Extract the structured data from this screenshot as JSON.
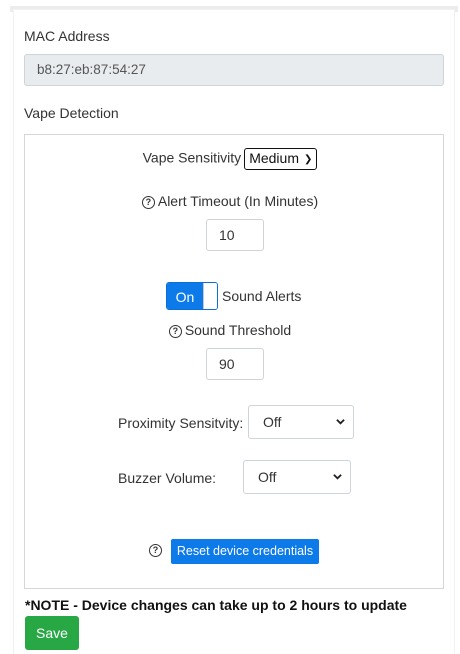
{
  "mac": {
    "label": "MAC Address",
    "value": "b8:27:eb:87:54:27"
  },
  "vape": {
    "section_label": "Vape Detection",
    "sensitivity_label": "Vape Sensitivity",
    "sensitivity_value": "Medium",
    "alert_timeout_label": "Alert Timeout (In Minutes)",
    "alert_timeout_value": "10",
    "sound_toggle_state": "On",
    "sound_alerts_label": "Sound Alerts",
    "sound_threshold_label": "Sound Threshold",
    "sound_threshold_value": "90",
    "proximity_label": "Proximity Sensitvity:",
    "proximity_value": "Off",
    "buzzer_label": "Buzzer Volume:",
    "buzzer_value": "Off",
    "reset_label": "Reset device credentials",
    "help_icon": "question-circle-icon"
  },
  "note": "*NOTE - Device changes can take up to 2 hours to update",
  "save_label": "Save",
  "colors": {
    "primary": "#0d7aea",
    "success": "#28a745",
    "readonly_bg": "#e9ecef"
  }
}
